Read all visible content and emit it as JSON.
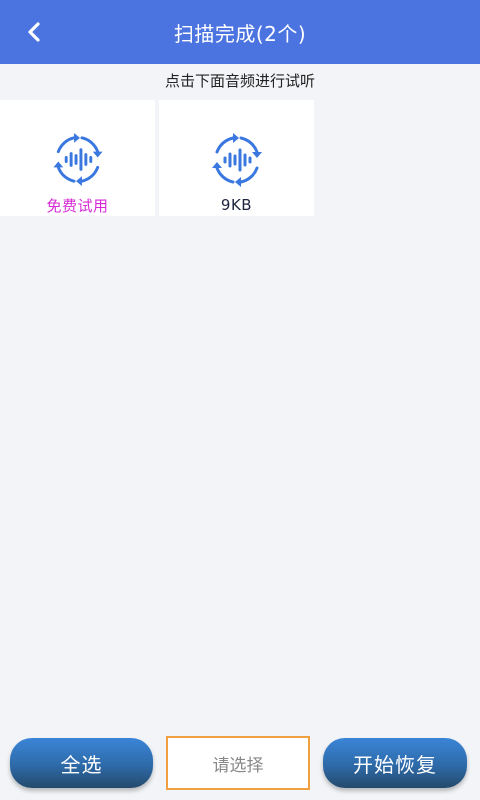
{
  "header": {
    "title": "扫描完成(2个)"
  },
  "hint": "点击下面音频进行试听",
  "files": [
    {
      "label": "免费试用",
      "icon": "audio-wave-icon"
    },
    {
      "label": "9KB",
      "icon": "audio-wave-icon"
    }
  ],
  "bottom": {
    "select_all": "全选",
    "select_placeholder": "请选择",
    "start_recovery": "开始恢复"
  },
  "colors": {
    "header_bg": "#4c74e0",
    "icon_blue": "#3a78e0",
    "trial_text": "#d62ad6",
    "select_border": "#f0a040"
  }
}
